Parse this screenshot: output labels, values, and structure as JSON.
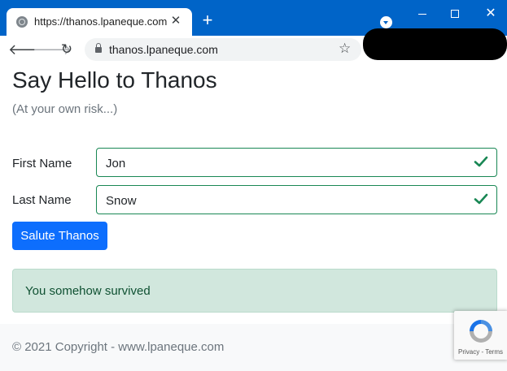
{
  "browser": {
    "tab_title": "https://thanos.lpaneque.com",
    "tab_close": "✕",
    "new_tab": "+",
    "address": "thanos.lpaneque.com",
    "window_close": "✕"
  },
  "page": {
    "heading": "Say Hello to Thanos",
    "subtitle": "(At your own risk...)",
    "form": {
      "first_name_label": "First Name",
      "first_name_value": "Jon",
      "last_name_label": "Last Name",
      "last_name_value": "Snow",
      "submit_label": "Salute Thanos"
    },
    "alert_text": "You somehow survived",
    "footer_text": "© 2021 Copyright - www.lpaneque.com"
  },
  "recaptcha": {
    "terms": "Privacy - Terms"
  },
  "colors": {
    "chrome_blue": "#0064c8",
    "primary": "#0d6efd",
    "success": "#198754",
    "alert_bg": "#d1e7dd",
    "alert_text": "#0f5132"
  }
}
